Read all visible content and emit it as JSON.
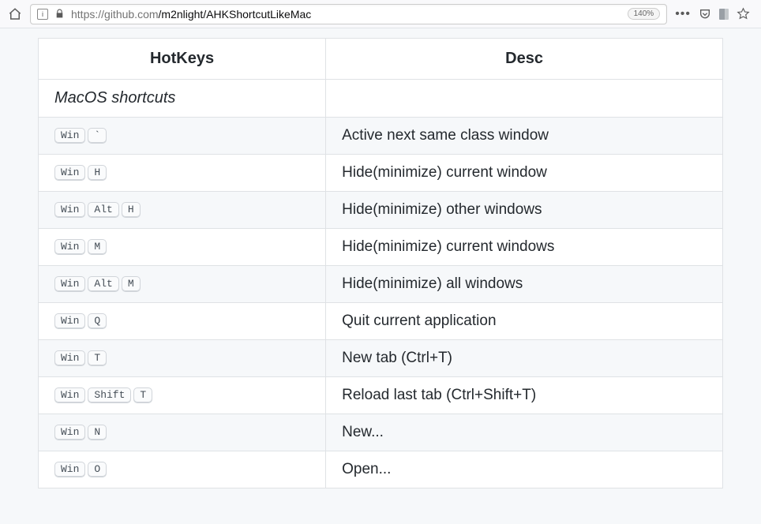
{
  "browser": {
    "url_host": "https://",
    "url_domain": "github.com",
    "url_path": "/m2nlight/AHKShortcutLikeMac",
    "zoom": "140%"
  },
  "table": {
    "headers": {
      "hotkeys": "HotKeys",
      "desc": "Desc"
    },
    "section_title": "MacOS shortcuts",
    "rows": [
      {
        "keys": [
          "Win",
          "`"
        ],
        "desc": "Active next same class window"
      },
      {
        "keys": [
          "Win",
          "H"
        ],
        "desc": "Hide(minimize) current window"
      },
      {
        "keys": [
          "Win",
          "Alt",
          "H"
        ],
        "desc": "Hide(minimize) other windows"
      },
      {
        "keys": [
          "Win",
          "M"
        ],
        "desc": "Hide(minimize) current windows"
      },
      {
        "keys": [
          "Win",
          "Alt",
          "M"
        ],
        "desc": "Hide(minimize) all windows"
      },
      {
        "keys": [
          "Win",
          "Q"
        ],
        "desc": "Quit current application"
      },
      {
        "keys": [
          "Win",
          "T"
        ],
        "desc": "New tab (Ctrl+T)"
      },
      {
        "keys": [
          "Win",
          "Shift",
          "T"
        ],
        "desc": "Reload last tab (Ctrl+Shift+T)"
      },
      {
        "keys": [
          "Win",
          "N"
        ],
        "desc": "New..."
      },
      {
        "keys": [
          "Win",
          "O"
        ],
        "desc": "Open..."
      }
    ]
  }
}
